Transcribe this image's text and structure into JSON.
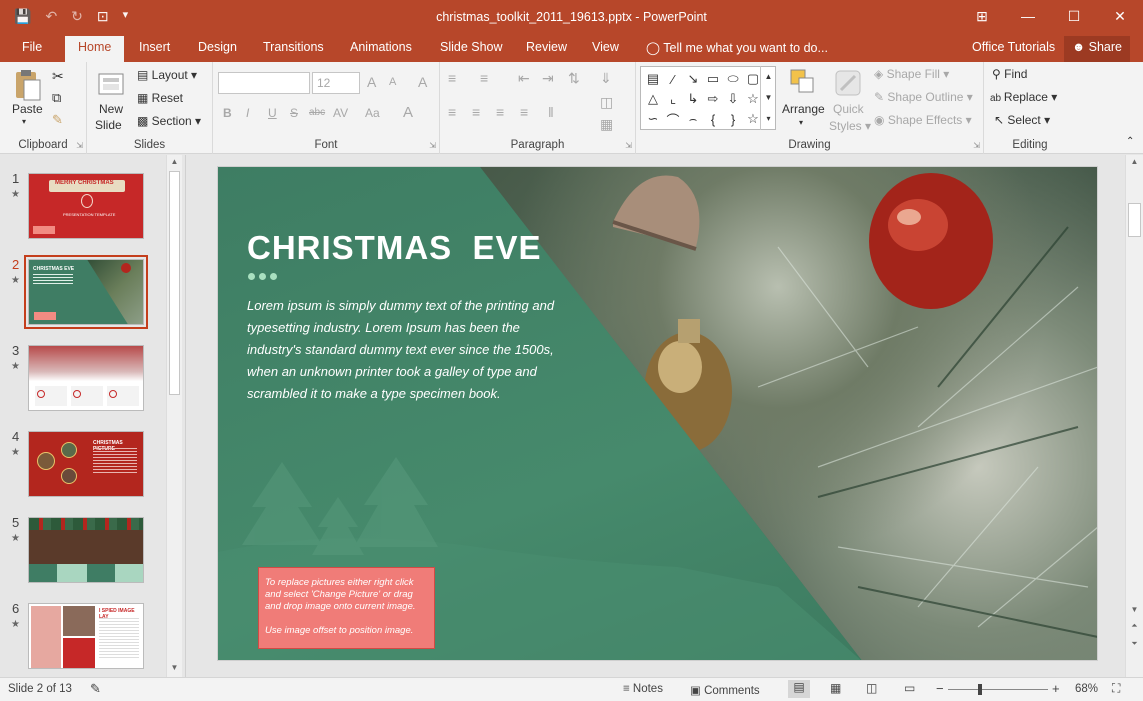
{
  "window": {
    "title": "christmas_toolkit_2011_19613.pptx - PowerPoint"
  },
  "qat": {
    "save_icon": "💾",
    "undo_icon": "↶",
    "redo_icon": "↻",
    "present_icon": "⊡",
    "more_icon": "▾"
  },
  "window_controls": {
    "ribbon_opts": "⊞",
    "minimize": "—",
    "maximize": "☐",
    "close": "✕"
  },
  "tabs": [
    "File",
    "Home",
    "Insert",
    "Design",
    "Transitions",
    "Animations",
    "Slide Show",
    "Review",
    "View"
  ],
  "tell_me": "Tell me what you want to do...",
  "office_tutorials": "Office Tutorials",
  "share": "Share",
  "ribbon": {
    "clipboard": {
      "label": "Clipboard",
      "paste": "Paste",
      "paste_caret": "▾"
    },
    "slides": {
      "label": "Slides",
      "new_slide": "New",
      "new_slide2": "Slide",
      "layout": "Layout",
      "reset": "Reset",
      "section": "Section"
    },
    "font": {
      "label": "Font",
      "size": "12",
      "grow": "A",
      "shrink": "A",
      "clear": "A",
      "bold": "B",
      "italic": "I",
      "underline": "U",
      "strike": "S",
      "strike2": "abc",
      "spacing": "AV",
      "case": "Aa",
      "color": "A"
    },
    "paragraph": {
      "label": "Paragraph"
    },
    "drawing": {
      "label": "Drawing",
      "arrange": "Arrange",
      "quick": "Quick",
      "styles": "Styles",
      "fill": "Shape Fill",
      "outline": "Shape Outline",
      "effects": "Shape Effects"
    },
    "editing": {
      "label": "Editing",
      "find": "Find",
      "replace": "Replace",
      "select": "Select"
    }
  },
  "thumbnails": [
    {
      "num": "1",
      "title": "MERRY CHRISTMAS",
      "sub": "PRESENTATION TEMPLATE"
    },
    {
      "num": "2",
      "title": "CHRISTMAS EVE"
    },
    {
      "num": "3"
    },
    {
      "num": "4",
      "title": "CHRISTMAS PICTURE"
    },
    {
      "num": "5"
    },
    {
      "num": "6",
      "title": "I SPIED IMAGE LAY"
    }
  ],
  "slide": {
    "title": "CHRISTMAS  EVE",
    "body": "Lorem ipsum is simply dummy text of the printing and typesetting industry. Lorem Ipsum has been the industry's standard dummy text ever since the 1500s, when an unknown printer took a galley of type and scrambled it to make a type specimen book.",
    "note1": "To replace pictures either right click and select 'Change Picture' or drag and drop image onto current image.",
    "note2": "Use image offset to position image."
  },
  "status": {
    "slide_info": "Slide 2 of 13",
    "notes": "Notes",
    "comments": "Comments",
    "zoom": "68%"
  },
  "colors": {
    "accent": "#b7472a",
    "slide_green": "#3f7d64",
    "note_pink": "#f28b82"
  }
}
